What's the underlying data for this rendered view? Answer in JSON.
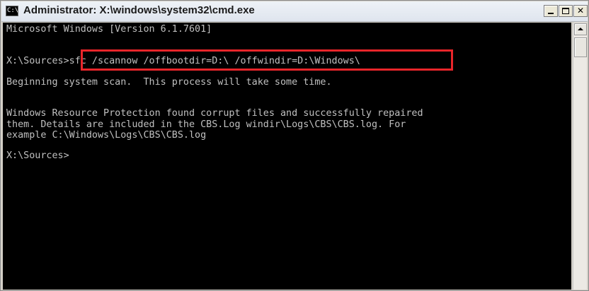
{
  "window": {
    "title": "Administrator: X:\\windows\\system32\\cmd.exe",
    "icon_label": "C:\\",
    "controls": {
      "minimize_label": "",
      "maximize_label": "",
      "close_label": "✕"
    }
  },
  "console": {
    "lines": [
      "Microsoft Windows [Version 6.1.7601]",
      "",
      "X:\\Sources>sfc /scannow /offbootdir=D:\\ /offwindir=D:\\Windows\\",
      "Beginning system scan.  This process will take some time.",
      "",
      "Windows Resource Protection found corrupt files and successfully repaired",
      "them. Details are included in the CBS.Log windir\\Logs\\CBS\\CBS.log. For",
      "example C:\\Windows\\Logs\\CBS\\CBS.log",
      "",
      "X:\\Sources>"
    ],
    "text_color": "#c0c0c0",
    "background_color": "#000000",
    "highlight_color": "#e8252a"
  }
}
